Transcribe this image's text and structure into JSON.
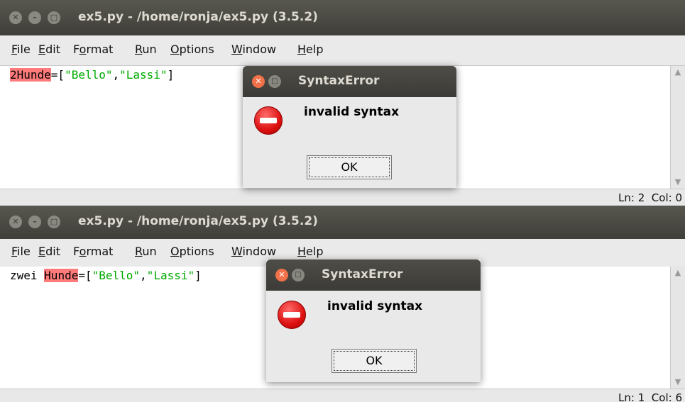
{
  "windows": [
    {
      "title": "ex5.py - /home/ronja/ex5.py (3.5.2)",
      "menu": [
        "File",
        "Edit",
        "Format",
        "Run",
        "Options",
        "Window",
        "Help"
      ],
      "menu_underline": [
        "F",
        "E",
        "o",
        "R",
        "O",
        "W",
        "H"
      ],
      "code": {
        "prefix": "",
        "error_token": "2Hunde",
        "rest": "=[",
        "str1": "\"Bello\"",
        "comma": ",",
        "str2": "\"Lassi\"",
        "end": "]"
      },
      "status": "Ln: 2  Col: 0",
      "dialog": {
        "title": "SyntaxError",
        "message": "invalid syntax",
        "ok": "OK"
      }
    },
    {
      "title": "ex5.py - /home/ronja/ex5.py (3.5.2)",
      "menu": [
        "File",
        "Edit",
        "Format",
        "Run",
        "Options",
        "Window",
        "Help"
      ],
      "menu_underline": [
        "F",
        "E",
        "o",
        "R",
        "O",
        "W",
        "H"
      ],
      "code": {
        "prefix": "zwei ",
        "error_token": "Hunde",
        "rest": "=[",
        "str1": "\"Bello\"",
        "comma": ",",
        "str2": "\"Lassi\"",
        "end": "]"
      },
      "status": "Ln: 1  Col: 6",
      "dialog": {
        "title": "SyntaxError",
        "message": "invalid syntax",
        "ok": "OK"
      }
    }
  ],
  "colors": {
    "titlebar": "#4a4943",
    "error_highlight": "#ff7b7b",
    "string": "#00aa00",
    "close_button": "#f1714a"
  },
  "icons": [
    "close-icon",
    "minimize-icon",
    "maximize-icon",
    "error-icon",
    "scroll-up-icon",
    "scroll-down-icon"
  ]
}
